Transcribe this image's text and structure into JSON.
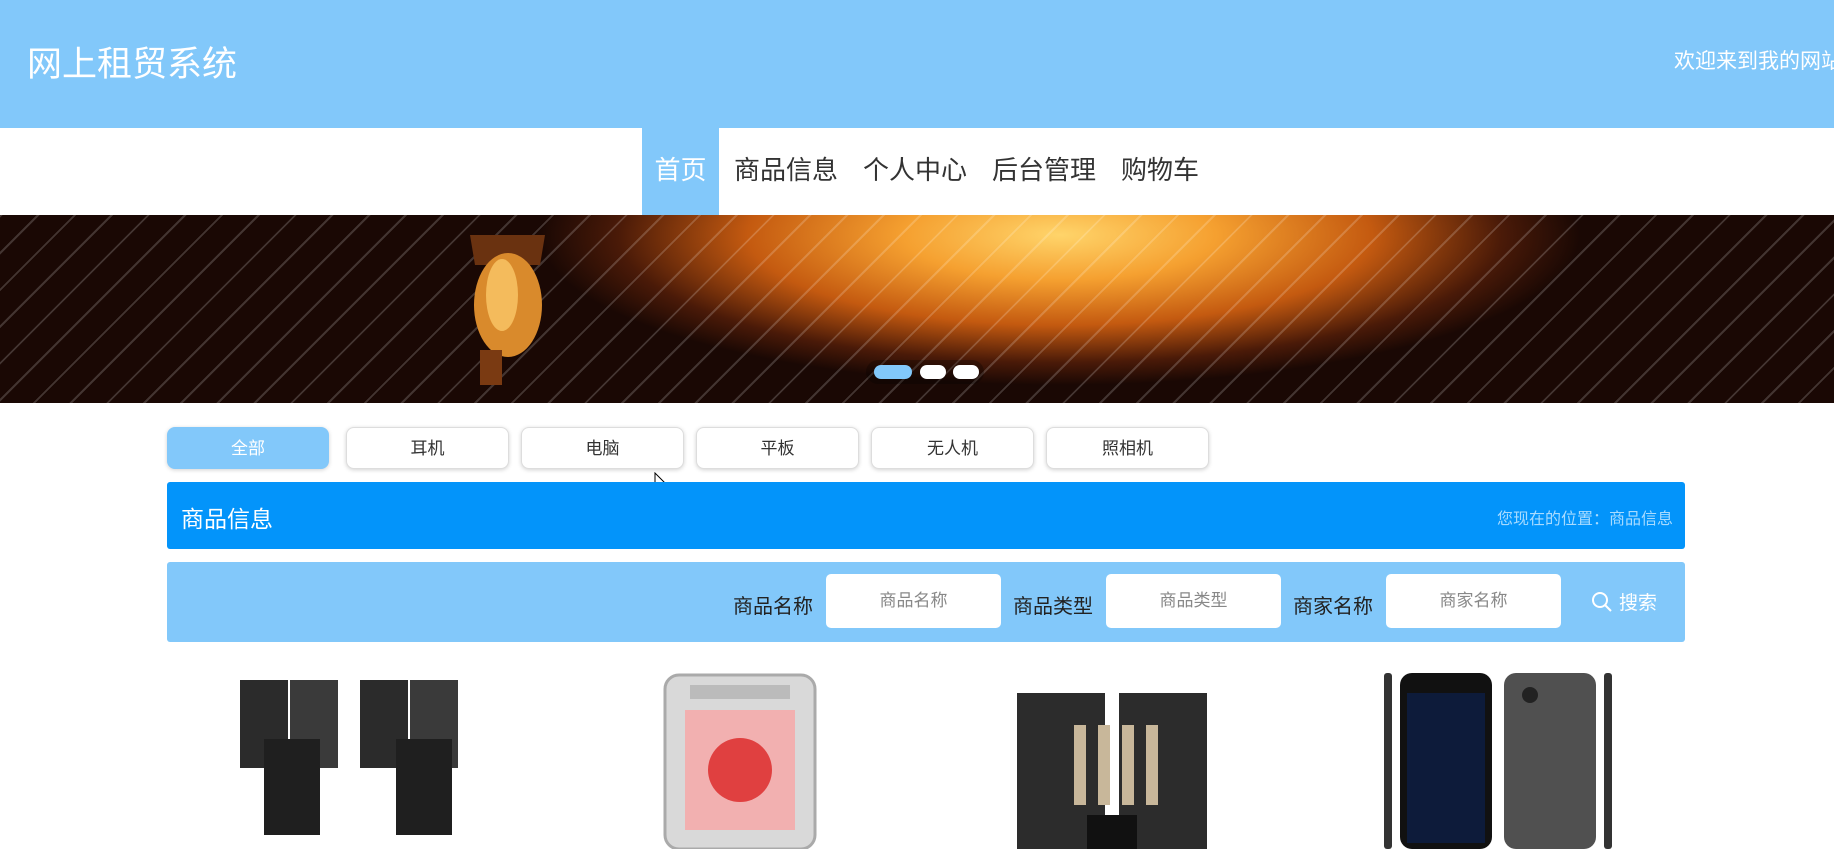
{
  "header": {
    "title": "网上租贸系统",
    "welcome": "欢迎来到我的网站"
  },
  "nav": {
    "items": [
      {
        "label": "首页",
        "active": true
      },
      {
        "label": "商品信息"
      },
      {
        "label": "个人中心"
      },
      {
        "label": "后台管理"
      },
      {
        "label": "购物车"
      }
    ]
  },
  "banner": {
    "active_slide": 1,
    "slide_count": 3
  },
  "categories": [
    {
      "label": "全部",
      "active": true
    },
    {
      "label": "耳机"
    },
    {
      "label": "电脑"
    },
    {
      "label": "平板"
    },
    {
      "label": "无人机"
    },
    {
      "label": "照相机"
    }
  ],
  "section": {
    "title": "商品信息",
    "location": "您现在的位置：商品信息"
  },
  "search": {
    "name_label": "商品名称",
    "name_placeholder": "商品名称",
    "type_label": "商品类型",
    "type_placeholder": "商品类型",
    "merchant_label": "商家名称",
    "merchant_placeholder": "商家名称",
    "button_label": "搜索"
  },
  "colors": {
    "primary": "#82c8fa",
    "accent": "#0394fa"
  },
  "icons": {
    "search": "search-icon"
  },
  "products": [
    {
      "image": "speakers-product-image"
    },
    {
      "image": "pc-case-product-image"
    },
    {
      "image": "karaoke-speaker-product-image"
    },
    {
      "image": "phone-product-image"
    }
  ]
}
